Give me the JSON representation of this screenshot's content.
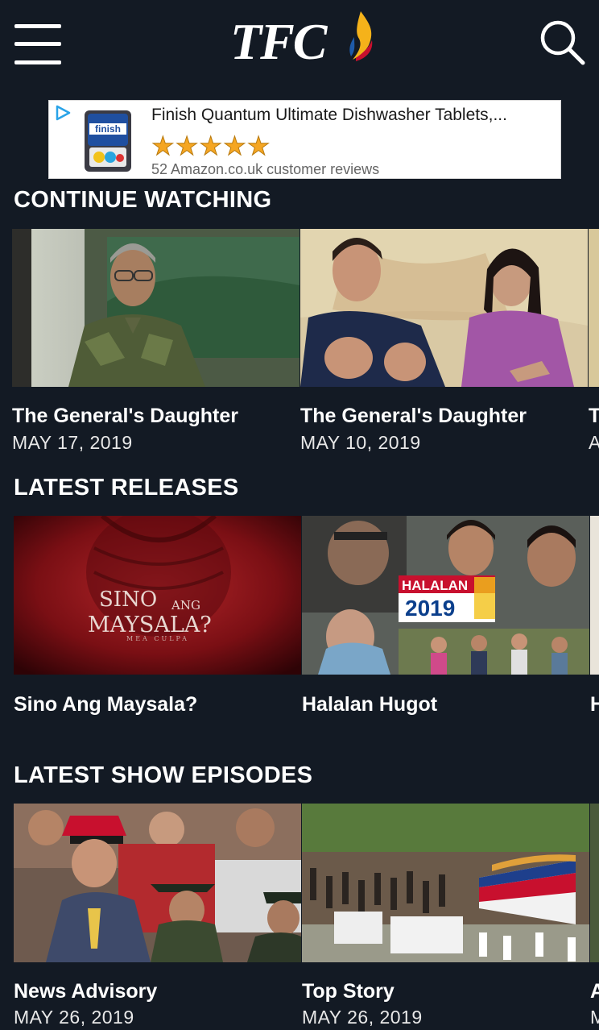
{
  "header": {
    "logo_text": "TFC",
    "menu_icon": "hamburger-menu-icon",
    "search_icon": "search-icon"
  },
  "ad": {
    "title": "Finish Quantum Ultimate Dishwasher Tablets,...",
    "stars": "★★★★★",
    "rating": 5,
    "reviews": "52 Amazon.co.uk customer reviews",
    "brand_text": "finish"
  },
  "sections": {
    "continue_watching": {
      "title": "CONTINUE WATCHING",
      "items": [
        {
          "title": "The General's Daughter",
          "date": "MAY 17, 2019"
        },
        {
          "title": "The General's Daughter",
          "date": "MAY 10, 2019"
        },
        {
          "title": "T",
          "date": "A"
        }
      ]
    },
    "latest_releases": {
      "title": "LATEST RELEASES",
      "items": [
        {
          "title": "Sino Ang Maysala?",
          "art_line1": "SINO",
          "art_ang": "ANG",
          "art_line2": "MAYSALA?",
          "art_sub": "MEA CULPA"
        },
        {
          "title": "Halalan Hugot",
          "art_line1": "HALALAN",
          "art_line2": "2019"
        },
        {
          "title": "H"
        }
      ]
    },
    "latest_show_episodes": {
      "title": "LATEST SHOW EPISODES",
      "items": [
        {
          "title": "News Advisory",
          "date": "MAY 26, 2019"
        },
        {
          "title": "Top Story",
          "date": "MAY 26, 2019"
        },
        {
          "title": "A",
          "date": "M"
        }
      ]
    }
  },
  "colors": {
    "background": "#131a24",
    "text": "#ffffff",
    "star": "#f5a623"
  }
}
